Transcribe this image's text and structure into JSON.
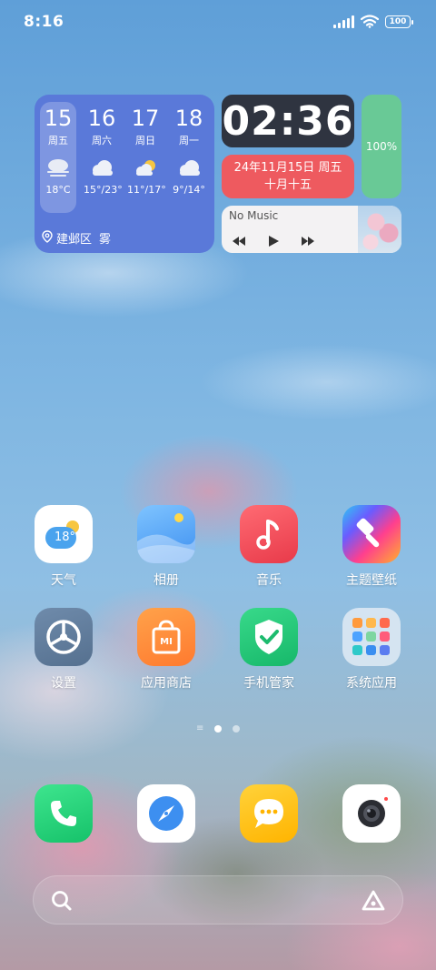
{
  "status_bar": {
    "time": "8:16",
    "battery": "100"
  },
  "weather": {
    "days": [
      {
        "date": "15",
        "weekday": "周五",
        "temp": "18°C",
        "icon": "fog-icon"
      },
      {
        "date": "16",
        "weekday": "周六",
        "temp": "15°/23°",
        "icon": "cloud-icon"
      },
      {
        "date": "17",
        "weekday": "周日",
        "temp": "11°/17°",
        "icon": "partly-sunny-icon"
      },
      {
        "date": "18",
        "weekday": "周一",
        "temp": "9°/14°",
        "icon": "cloud-icon"
      }
    ],
    "location": "建邺区",
    "condition": "雾"
  },
  "clock": {
    "time": "02:36"
  },
  "date_widget": {
    "line1": "24年11月15日 周五",
    "line2": "十月十五"
  },
  "battery_widget": {
    "level": "100%"
  },
  "music": {
    "title": "No Music"
  },
  "apps": [
    {
      "label": "天气",
      "badge": "18°"
    },
    {
      "label": "相册"
    },
    {
      "label": "音乐"
    },
    {
      "label": "主题壁纸"
    },
    {
      "label": "设置"
    },
    {
      "label": "应用商店",
      "badge": "MI"
    },
    {
      "label": "手机管家"
    },
    {
      "label": "系统应用"
    }
  ],
  "dock": [
    {
      "name": "phone"
    },
    {
      "name": "browser"
    },
    {
      "name": "messages"
    },
    {
      "name": "camera"
    }
  ],
  "colors": {
    "weather_bg": "#5a79d9",
    "clock_bg": "#2f3440",
    "date_bg": "#ee5a5f",
    "battery_bg": "#69c996"
  }
}
